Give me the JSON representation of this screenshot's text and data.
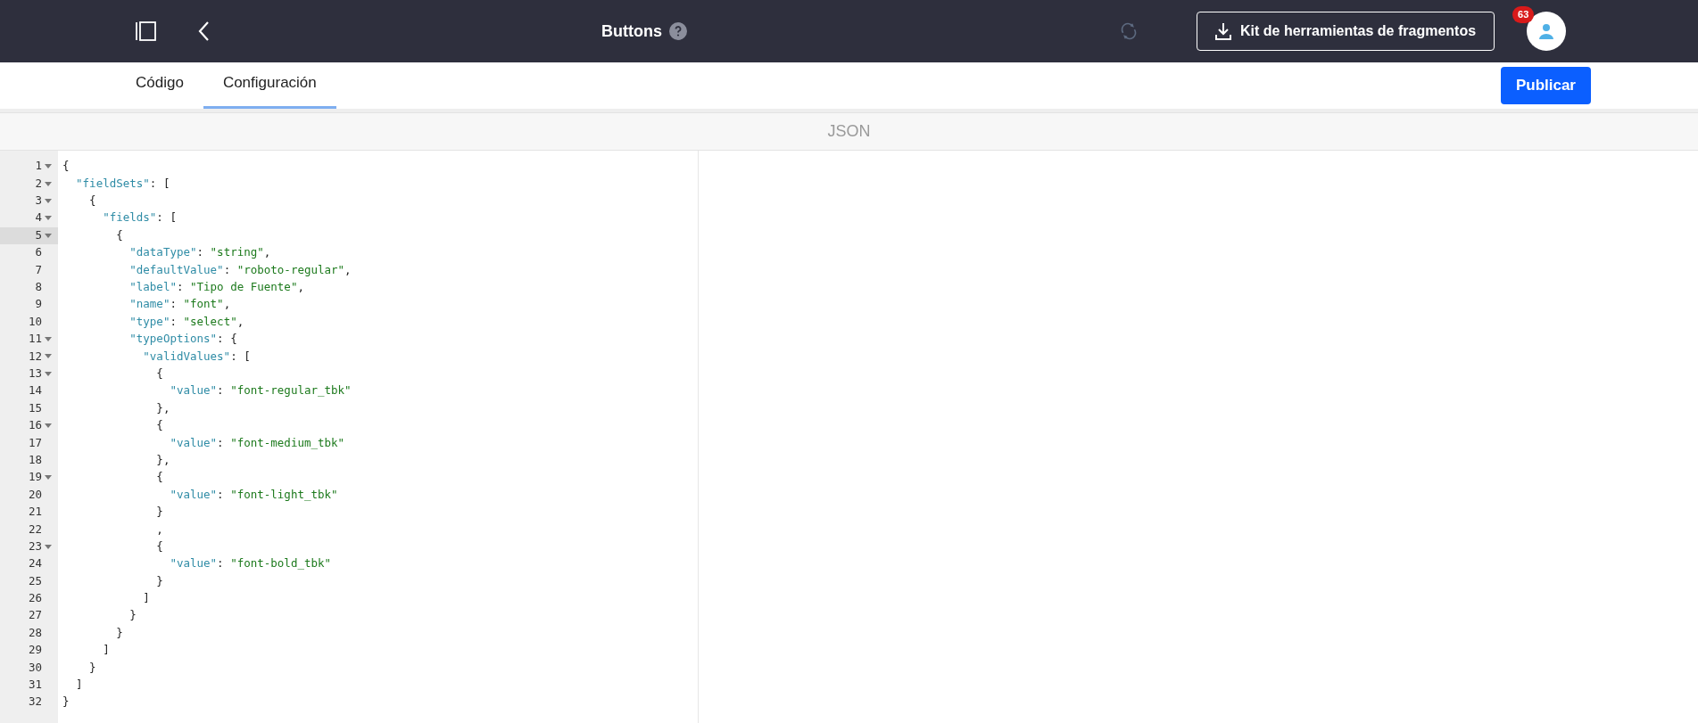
{
  "header": {
    "title": "Buttons",
    "toolkit_button": "Kit de herramientas de fragmentos",
    "notification_count": "63"
  },
  "tabs": [
    {
      "label": "Código",
      "selected": false
    },
    {
      "label": "Configuración",
      "selected": true
    }
  ],
  "publish_button": "Publicar",
  "editor": {
    "title": "JSON",
    "lines": [
      {
        "number": "1",
        "foldable": true,
        "active": false,
        "tokens": [
          {
            "kind": "punct",
            "text": "{"
          }
        ]
      },
      {
        "number": "2",
        "foldable": true,
        "active": false,
        "tokens": [
          {
            "kind": "key",
            "text": "  \"fieldSets\""
          },
          {
            "kind": "punct",
            "text": ": ["
          }
        ]
      },
      {
        "number": "3",
        "foldable": true,
        "active": false,
        "tokens": [
          {
            "kind": "punct",
            "text": "    {"
          }
        ]
      },
      {
        "number": "4",
        "foldable": true,
        "active": false,
        "tokens": [
          {
            "kind": "key",
            "text": "      \"fields\""
          },
          {
            "kind": "punct",
            "text": ": ["
          }
        ]
      },
      {
        "number": "5",
        "foldable": true,
        "active": true,
        "tokens": [
          {
            "kind": "punct",
            "text": "        {"
          }
        ]
      },
      {
        "number": "6",
        "foldable": false,
        "active": false,
        "tokens": [
          {
            "kind": "key",
            "text": "          \"dataType\""
          },
          {
            "kind": "punct",
            "text": ": "
          },
          {
            "kind": "string",
            "text": "\"string\""
          },
          {
            "kind": "punct",
            "text": ","
          }
        ]
      },
      {
        "number": "7",
        "foldable": false,
        "active": false,
        "tokens": [
          {
            "kind": "key",
            "text": "          \"defaultValue\""
          },
          {
            "kind": "punct",
            "text": ": "
          },
          {
            "kind": "string",
            "text": "\"roboto-regular\""
          },
          {
            "kind": "punct",
            "text": ","
          }
        ]
      },
      {
        "number": "8",
        "foldable": false,
        "active": false,
        "tokens": [
          {
            "kind": "key",
            "text": "          \"label\""
          },
          {
            "kind": "punct",
            "text": ": "
          },
          {
            "kind": "string",
            "text": "\"Tipo de Fuente\""
          },
          {
            "kind": "punct",
            "text": ","
          }
        ]
      },
      {
        "number": "9",
        "foldable": false,
        "active": false,
        "tokens": [
          {
            "kind": "key",
            "text": "          \"name\""
          },
          {
            "kind": "punct",
            "text": ": "
          },
          {
            "kind": "string",
            "text": "\"font\""
          },
          {
            "kind": "punct",
            "text": ","
          }
        ]
      },
      {
        "number": "10",
        "foldable": false,
        "active": false,
        "tokens": [
          {
            "kind": "key",
            "text": "          \"type\""
          },
          {
            "kind": "punct",
            "text": ": "
          },
          {
            "kind": "string",
            "text": "\"select\""
          },
          {
            "kind": "punct",
            "text": ","
          }
        ]
      },
      {
        "number": "11",
        "foldable": true,
        "active": false,
        "tokens": [
          {
            "kind": "key",
            "text": "          \"typeOptions\""
          },
          {
            "kind": "punct",
            "text": ": {"
          }
        ]
      },
      {
        "number": "12",
        "foldable": true,
        "active": false,
        "tokens": [
          {
            "kind": "key",
            "text": "            \"validValues\""
          },
          {
            "kind": "punct",
            "text": ": ["
          }
        ]
      },
      {
        "number": "13",
        "foldable": true,
        "active": false,
        "tokens": [
          {
            "kind": "punct",
            "text": "              {"
          }
        ]
      },
      {
        "number": "14",
        "foldable": false,
        "active": false,
        "tokens": [
          {
            "kind": "key",
            "text": "                \"value\""
          },
          {
            "kind": "punct",
            "text": ": "
          },
          {
            "kind": "string",
            "text": "\"font-regular_tbk\""
          }
        ]
      },
      {
        "number": "15",
        "foldable": false,
        "active": false,
        "tokens": [
          {
            "kind": "punct",
            "text": "              },"
          }
        ]
      },
      {
        "number": "16",
        "foldable": true,
        "active": false,
        "tokens": [
          {
            "kind": "punct",
            "text": "              {"
          }
        ]
      },
      {
        "number": "17",
        "foldable": false,
        "active": false,
        "tokens": [
          {
            "kind": "key",
            "text": "                \"value\""
          },
          {
            "kind": "punct",
            "text": ": "
          },
          {
            "kind": "string",
            "text": "\"font-medium_tbk\""
          }
        ]
      },
      {
        "number": "18",
        "foldable": false,
        "active": false,
        "tokens": [
          {
            "kind": "punct",
            "text": "              },"
          }
        ]
      },
      {
        "number": "19",
        "foldable": true,
        "active": false,
        "tokens": [
          {
            "kind": "punct",
            "text": "              {"
          }
        ]
      },
      {
        "number": "20",
        "foldable": false,
        "active": false,
        "tokens": [
          {
            "kind": "key",
            "text": "                \"value\""
          },
          {
            "kind": "punct",
            "text": ": "
          },
          {
            "kind": "string",
            "text": "\"font-light_tbk\""
          }
        ]
      },
      {
        "number": "21",
        "foldable": false,
        "active": false,
        "tokens": [
          {
            "kind": "punct",
            "text": "              }"
          }
        ]
      },
      {
        "number": "22",
        "foldable": false,
        "active": false,
        "tokens": [
          {
            "kind": "punct",
            "text": "              ,"
          }
        ]
      },
      {
        "number": "23",
        "foldable": true,
        "active": false,
        "tokens": [
          {
            "kind": "punct",
            "text": "              {"
          }
        ]
      },
      {
        "number": "24",
        "foldable": false,
        "active": false,
        "tokens": [
          {
            "kind": "key",
            "text": "                \"value\""
          },
          {
            "kind": "punct",
            "text": ": "
          },
          {
            "kind": "string",
            "text": "\"font-bold_tbk\""
          }
        ]
      },
      {
        "number": "25",
        "foldable": false,
        "active": false,
        "tokens": [
          {
            "kind": "punct",
            "text": "              }"
          }
        ]
      },
      {
        "number": "26",
        "foldable": false,
        "active": false,
        "tokens": [
          {
            "kind": "punct",
            "text": "            ]"
          }
        ]
      },
      {
        "number": "27",
        "foldable": false,
        "active": false,
        "tokens": [
          {
            "kind": "punct",
            "text": "          }"
          }
        ]
      },
      {
        "number": "28",
        "foldable": false,
        "active": false,
        "tokens": [
          {
            "kind": "punct",
            "text": "        }"
          }
        ]
      },
      {
        "number": "29",
        "foldable": false,
        "active": false,
        "tokens": [
          {
            "kind": "punct",
            "text": "      ]"
          }
        ]
      },
      {
        "number": "30",
        "foldable": false,
        "active": false,
        "tokens": [
          {
            "kind": "punct",
            "text": "    }"
          }
        ]
      },
      {
        "number": "31",
        "foldable": false,
        "active": false,
        "tokens": [
          {
            "kind": "punct",
            "text": "  ]"
          }
        ]
      },
      {
        "number": "32",
        "foldable": false,
        "active": false,
        "tokens": [
          {
            "kind": "punct",
            "text": "}"
          }
        ]
      }
    ]
  }
}
